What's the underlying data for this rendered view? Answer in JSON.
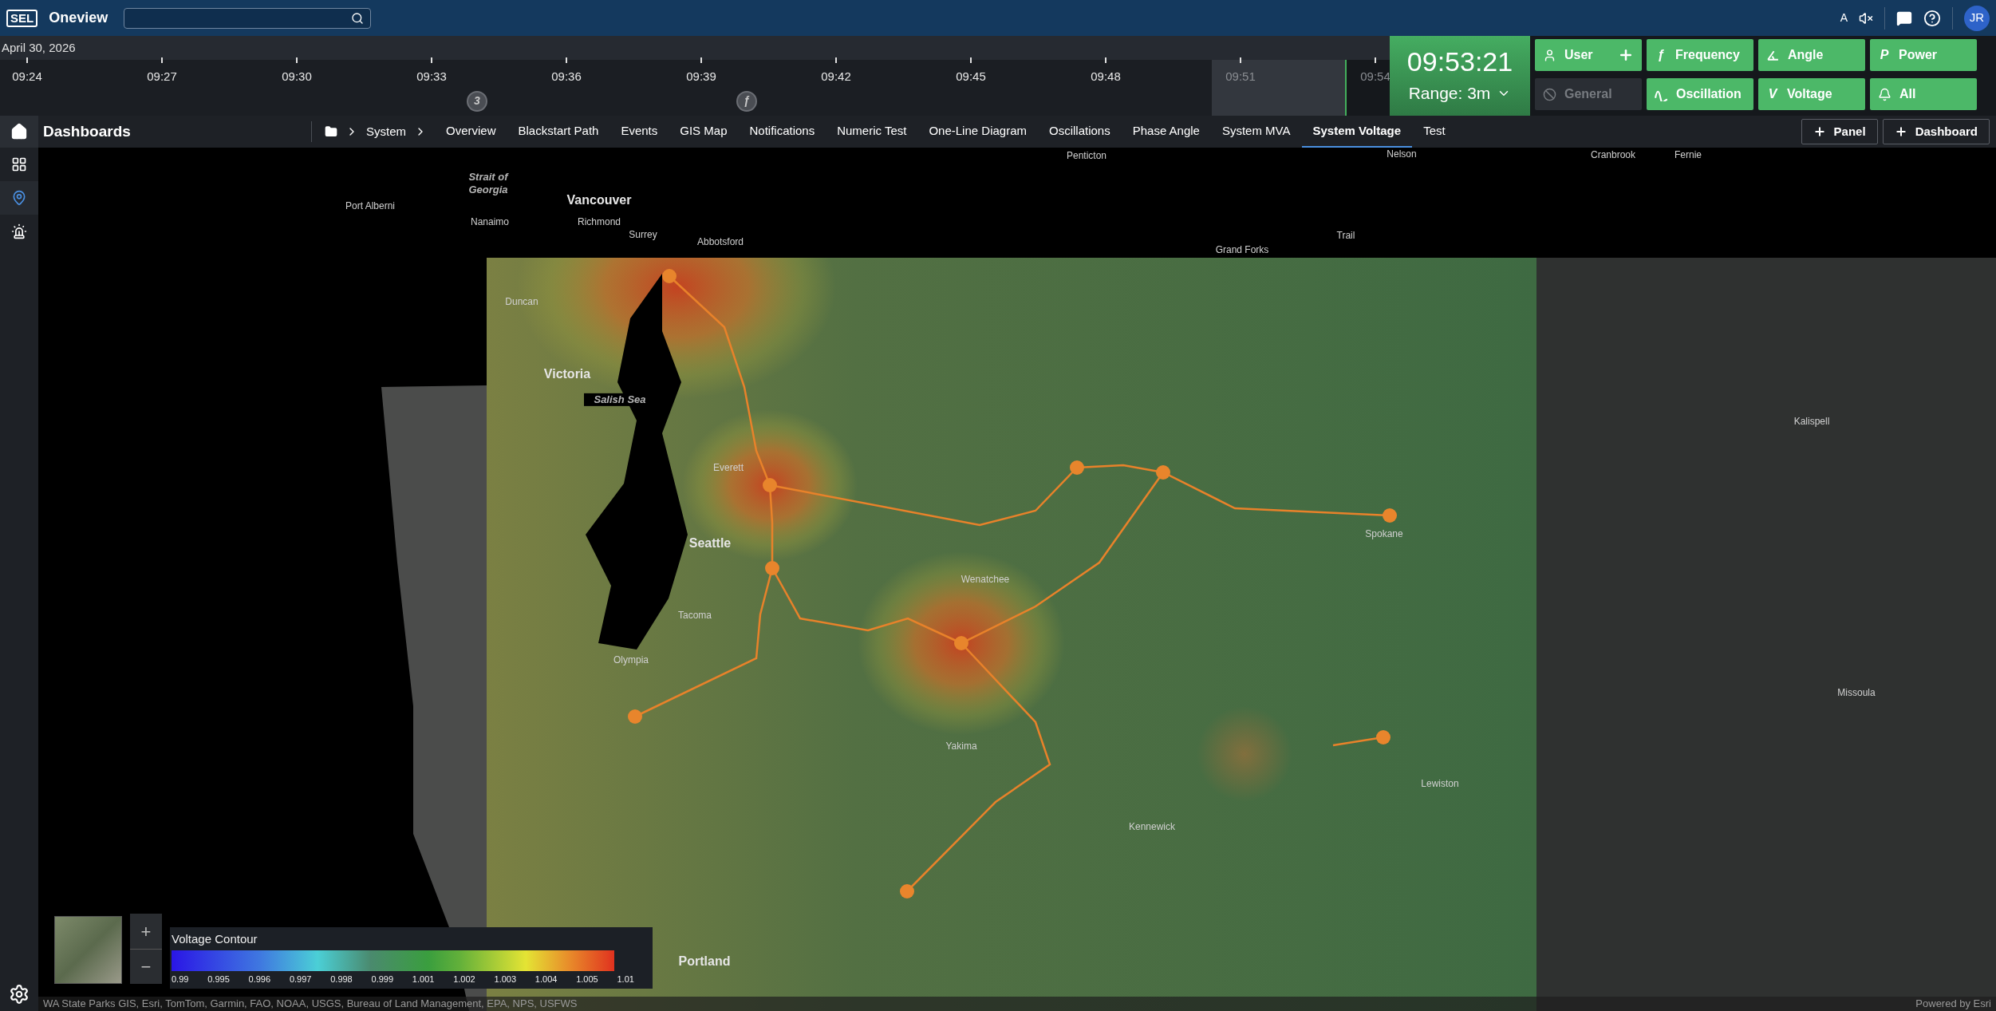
{
  "header": {
    "logo": "SEL",
    "app_name": "Oneview",
    "language": "A",
    "avatar": "JR"
  },
  "timeline": {
    "date": "April 30, 2026",
    "ticks": [
      {
        "label": "09:24",
        "kind": "past"
      },
      {
        "label": "09:27",
        "kind": "past"
      },
      {
        "label": "09:30",
        "kind": "past"
      },
      {
        "label": "09:33",
        "kind": "past",
        "event": "3"
      },
      {
        "label": "09:36",
        "kind": "past"
      },
      {
        "label": "09:39",
        "kind": "past",
        "event": "ƒ"
      },
      {
        "label": "09:42",
        "kind": "past"
      },
      {
        "label": "09:45",
        "kind": "past"
      },
      {
        "label": "09:48",
        "kind": "past"
      },
      {
        "label": "09:51",
        "kind": "range"
      },
      {
        "label": "09:54",
        "kind": "future"
      }
    ]
  },
  "clock": {
    "time": "09:53:21",
    "range": "Range: 3m"
  },
  "filters": [
    {
      "label": "User",
      "addable": true,
      "disabled": false
    },
    {
      "label": "Frequency",
      "glyph": "ƒ",
      "disabled": false
    },
    {
      "label": "Angle",
      "disabled": false
    },
    {
      "label": "Power",
      "glyph": "P",
      "disabled": false
    },
    {
      "label": "General",
      "disabled": true
    },
    {
      "label": "Oscillation",
      "disabled": false
    },
    {
      "label": "Voltage",
      "glyph": "V",
      "disabled": false
    },
    {
      "label": "All",
      "disabled": false
    }
  ],
  "sidebar": {
    "items": [
      {
        "selected": false
      },
      {
        "selected": true
      },
      {
        "selected": false
      },
      {
        "selected": false
      }
    ]
  },
  "nav": {
    "title": "Dashboards",
    "breadcrumb": [
      "System"
    ],
    "tabs": [
      {
        "label": "Overview",
        "selected": false
      },
      {
        "label": "Blackstart Path",
        "selected": false
      },
      {
        "label": "Events",
        "selected": false
      },
      {
        "label": "GIS Map",
        "selected": false
      },
      {
        "label": "Notifications",
        "selected": false
      },
      {
        "label": "Numeric Test",
        "selected": false
      },
      {
        "label": "One-Line Diagram",
        "selected": false
      },
      {
        "label": "Oscillations",
        "selected": false
      },
      {
        "label": "Phase Angle",
        "selected": false
      },
      {
        "label": "System MVA",
        "selected": false
      },
      {
        "label": "System Voltage",
        "selected": true
      },
      {
        "label": "Test",
        "selected": false
      }
    ],
    "actions": [
      "Panel",
      "Dashboard"
    ]
  },
  "map": {
    "labels": [
      {
        "text": "Penticton",
        "kind": "city"
      },
      {
        "text": "Nelson",
        "kind": "city"
      },
      {
        "text": "Cranbrook",
        "kind": "city"
      },
      {
        "text": "Fernie",
        "kind": "city"
      },
      {
        "text": "Strait of Georgia",
        "kind": "water"
      },
      {
        "text": "Port Alberni",
        "kind": "city"
      },
      {
        "text": "Vancouver",
        "kind": "major"
      },
      {
        "text": "Nanaimo",
        "kind": "city"
      },
      {
        "text": "Richmond",
        "kind": "city"
      },
      {
        "text": "Surrey",
        "kind": "city"
      },
      {
        "text": "Abbotsford",
        "kind": "city"
      },
      {
        "text": "Grand Forks",
        "kind": "city"
      },
      {
        "text": "Trail",
        "kind": "city"
      },
      {
        "text": "Duncan",
        "kind": "city"
      },
      {
        "text": "Victoria",
        "kind": "major"
      },
      {
        "text": "Salish Sea",
        "kind": "water"
      },
      {
        "text": "Kalispell",
        "kind": "city"
      },
      {
        "text": "Everett",
        "kind": "city"
      },
      {
        "text": "Seattle",
        "kind": "major"
      },
      {
        "text": "Wenatchee",
        "kind": "city"
      },
      {
        "text": "Spokane",
        "kind": "city"
      },
      {
        "text": "Tacoma",
        "kind": "city"
      },
      {
        "text": "Olympia",
        "kind": "city"
      },
      {
        "text": "Missoula",
        "kind": "city"
      },
      {
        "text": "Yakima",
        "kind": "city"
      },
      {
        "text": "Lewiston",
        "kind": "city"
      },
      {
        "text": "Kennewick",
        "kind": "city"
      },
      {
        "text": "Portland",
        "kind": "major"
      }
    ],
    "zoom_controls": [
      "+",
      "−"
    ],
    "legend": {
      "title": "Voltage Contour",
      "ticks": [
        "0.99",
        "0.995",
        "0.996",
        "0.997",
        "0.998",
        "0.999",
        "1.001",
        "1.002",
        "1.003",
        "1.004",
        "1.005",
        "1.01"
      ]
    },
    "attribution": "WA State Parks GIS, Esri, TomTom, Garmin, FAO, NOAA, USGS, Bureau of Land Management, EPA, NPS, USFWS",
    "powered_by": "Powered by Esri"
  }
}
